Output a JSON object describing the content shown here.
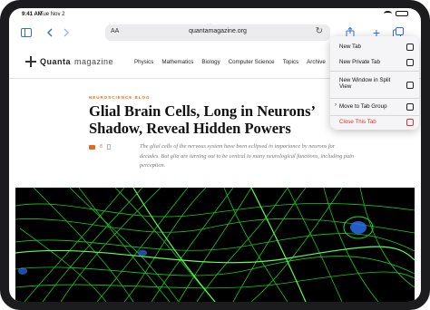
{
  "status_bar": {
    "time": "9:41 AM",
    "date": "Tue Nov 2",
    "battery": "100%"
  },
  "toolbar": {
    "sidebar_icon": "sidebar-icon",
    "back_icon": "chevron-left-icon",
    "forward_icon": "chevron-right-icon",
    "reader_label": "AA",
    "url": "quantamagazine.org",
    "share_icon": "share-icon",
    "new_tab_icon": "plus-icon",
    "tabs_icon": "tabs-overview-icon",
    "dots": "···"
  },
  "site": {
    "logo_bold": "Quanta",
    "logo_light": "magazine",
    "nav": [
      "Physics",
      "Mathematics",
      "Biology",
      "Computer Science",
      "Topics",
      "Archive"
    ]
  },
  "article": {
    "kicker": "NEUROSCIENCE BLOG",
    "title": "Glial Brain Cells, Long in Neurons’ Shadow, Reveal Hidden Powers",
    "comments": "8",
    "summary": "The glial cells of the nervous system have been eclipsed in importance by neurons for decades. But glia are turning out to be central to many neurological functions, including pain perception."
  },
  "menu": {
    "items": [
      {
        "label": "New Tab",
        "icon": "new-tab-icon"
      },
      {
        "label": "New Private Tab",
        "icon": "private-tab-icon"
      },
      {
        "label": "New Window in Split View",
        "icon": "split-view-icon"
      },
      {
        "label": "Move to Tab Group",
        "icon": "move-to-group-icon"
      },
      {
        "label": "Close This Tab",
        "icon": "close-tab-icon"
      }
    ]
  },
  "colors": {
    "accent": "#2f6fd6",
    "kicker": "#e26a18",
    "destructive": "#e0322b",
    "cell_green": "#19e01f"
  }
}
